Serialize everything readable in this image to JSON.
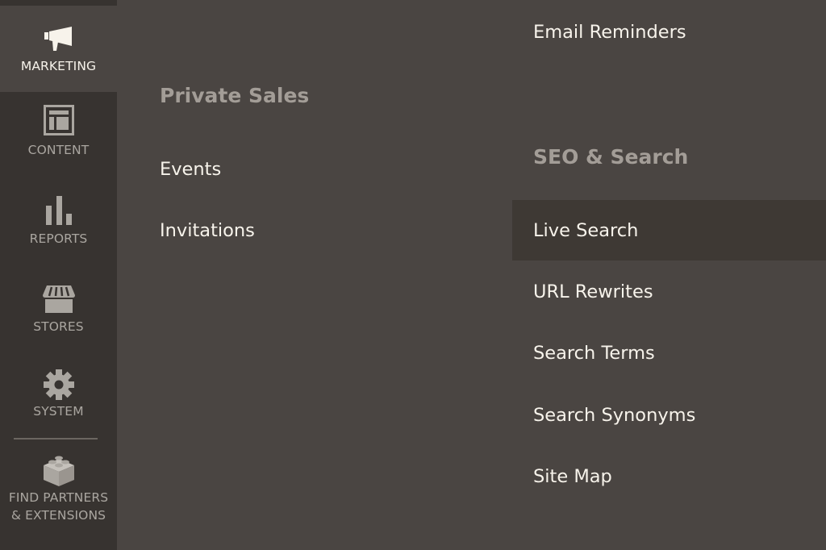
{
  "sidebar": {
    "items": [
      {
        "label": "MARKETING",
        "icon": "megaphone-icon",
        "active": true
      },
      {
        "label": "CONTENT",
        "icon": "content-layout-icon",
        "active": false
      },
      {
        "label": "REPORTS",
        "icon": "bar-chart-icon",
        "active": false
      },
      {
        "label": "STORES",
        "icon": "storefront-icon",
        "active": false
      },
      {
        "label": "SYSTEM",
        "icon": "gear-icon",
        "active": false
      },
      {
        "label_line1": "FIND PARTNERS",
        "label_line2": "& EXTENSIONS",
        "icon": "lego-brick-icon",
        "active": false
      }
    ]
  },
  "submenu": {
    "column_left": {
      "heading": "Private Sales",
      "links": [
        "Events",
        "Invitations"
      ]
    },
    "column_right": {
      "top_links": [
        "Email Reminders"
      ],
      "heading": "SEO & Search",
      "links": [
        "Live Search",
        "URL Rewrites",
        "Search Terms",
        "Search Synonyms",
        "Site Map"
      ],
      "hovered": "Live Search"
    }
  },
  "colors": {
    "sidebar_bg": "#373330",
    "panel_bg": "#4a4542",
    "hover_bg": "#3e3934",
    "link_text": "#f7f3eb",
    "heading_text": "#a39d97",
    "sidebar_text": "#aaa6a0"
  }
}
